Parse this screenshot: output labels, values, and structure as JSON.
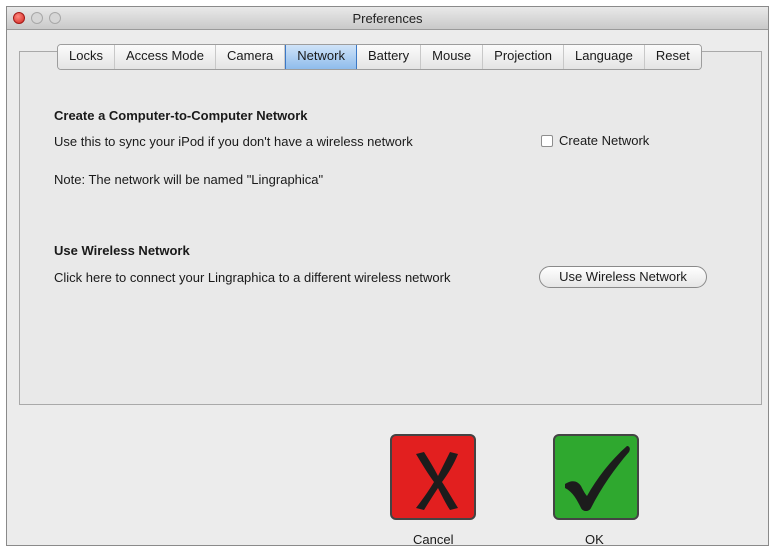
{
  "window": {
    "title": "Preferences"
  },
  "tabs": [
    {
      "label": "Locks"
    },
    {
      "label": "Access Mode"
    },
    {
      "label": "Camera"
    },
    {
      "label": "Network"
    },
    {
      "label": "Battery"
    },
    {
      "label": "Mouse"
    },
    {
      "label": "Projection"
    },
    {
      "label": "Language"
    },
    {
      "label": "Reset"
    }
  ],
  "active_tab": "Network",
  "network": {
    "adhoc_title": "Create a Computer-to-Computer Network",
    "adhoc_desc": "Use this to sync your iPod if you don't have a wireless network",
    "create_network_label": "Create Network",
    "create_network_checked": false,
    "note": "Note: The network will be named \"Lingraphica\"",
    "wireless_title": "Use Wireless Network",
    "wireless_desc": "Click here to connect your Lingraphica to a different wireless network",
    "wireless_button": "Use Wireless Network"
  },
  "footer": {
    "cancel_label": "Cancel",
    "ok_label": "OK"
  },
  "colors": {
    "cancel_bg": "#e21f1f",
    "ok_bg": "#2fa82f",
    "active_tab": "#8fbcec"
  }
}
